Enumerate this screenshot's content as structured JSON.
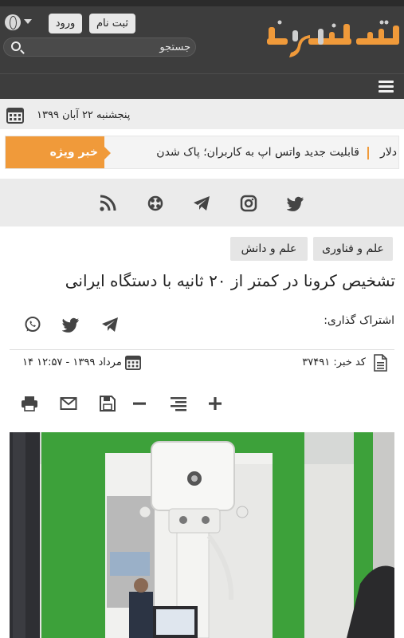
{
  "header": {
    "logo_text": "تهرآرانیوز",
    "login_label": "ورود",
    "register_label": "ثبت نام",
    "search_placeholder": "جستجو"
  },
  "datebar": {
    "date": "پنجشنبه ۲۲ آبان ۱۳۹۹"
  },
  "ticker": {
    "label": "خبر ویژه",
    "items": [
      "قابلیت جدید واتس اپ به کاربران؛ پاک شدن",
      "دلار"
    ]
  },
  "social": [
    "rss-icon",
    "aparat-icon",
    "telegram-icon",
    "instagram-icon",
    "twitter-icon"
  ],
  "article": {
    "tags": [
      "علم و فناوری",
      "علم و دانش"
    ],
    "title": "تشخیص کرونا در کمتر از ۲۰ ثانیه با دستگاه ایرانی",
    "share_label": "اشتراک گذاری:",
    "news_code": "کد خبر: ۳۷۴۹۱",
    "published": "۱۴ مرداد ۱۳۹۹ - ۱۲:۵۷"
  },
  "colors": {
    "header_bg": "#3d3d3d",
    "accent": "#f09a3a",
    "tag_bg": "#e5e5e5"
  }
}
